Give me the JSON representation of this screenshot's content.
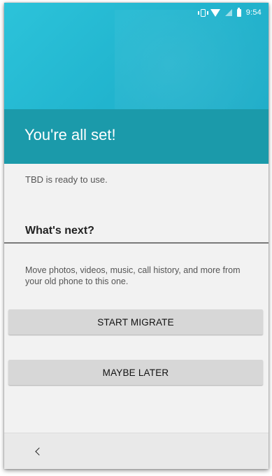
{
  "status_bar": {
    "time": "9:54",
    "icons": [
      "vibrate-icon",
      "wifi-icon",
      "signal-icon",
      "battery-icon"
    ]
  },
  "header": {
    "title": "You're all set!"
  },
  "main": {
    "ready_text": "TBD is ready to use.",
    "next_heading": "What's next?",
    "description": "Move photos, videos, music, call history, and more from your old phone to this one.",
    "start_button_label": "START MIGRATE",
    "later_button_label": "MAYBE LATER"
  },
  "nav": {
    "back_icon": "back-chevron-icon"
  },
  "colors": {
    "hero_top": "#2cc3da",
    "title_band": "#1b9aaa",
    "button_bg": "#d7d7d7",
    "body_bg": "#f2f2f2",
    "nav_bg": "#e9e9e9"
  }
}
